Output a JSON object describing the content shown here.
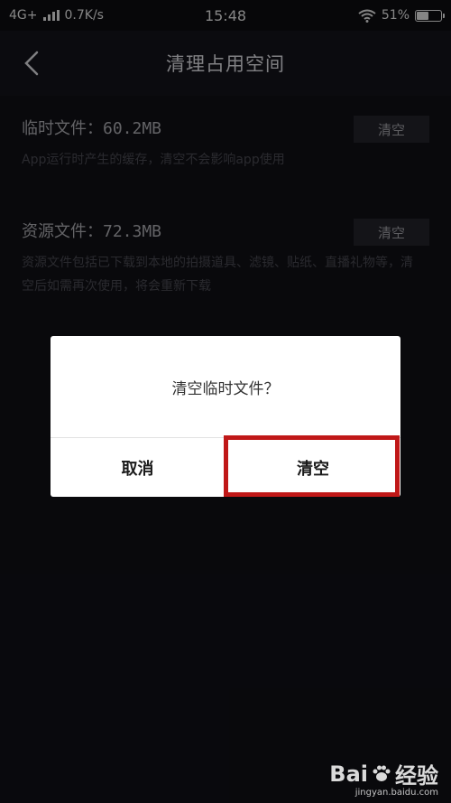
{
  "statusbar": {
    "network": "4G+",
    "speed": "0.7K/s",
    "time": "15:48",
    "battery": "51%",
    "battery_level": 0.51
  },
  "navbar": {
    "title": "清理占用空间"
  },
  "items": [
    {
      "title": "临时文件：60.2MB",
      "desc": "App运行时产生的缓存，清空不会影响app使用",
      "button": "清空"
    },
    {
      "title": "资源文件：72.3MB",
      "desc": "资源文件包括已下载到本地的拍摄道具、滤镜、贴纸、直播礼物等，清空后如需再次使用，将会重新下载",
      "button": "清空"
    }
  ],
  "dialog": {
    "message": "清空临时文件？",
    "cancel": "取消",
    "confirm": "清空",
    "highlight_color": "#c01818"
  },
  "watermark": {
    "brand_left": "Bai",
    "brand_right": "经验",
    "url": "jingyan.baidu.com"
  }
}
